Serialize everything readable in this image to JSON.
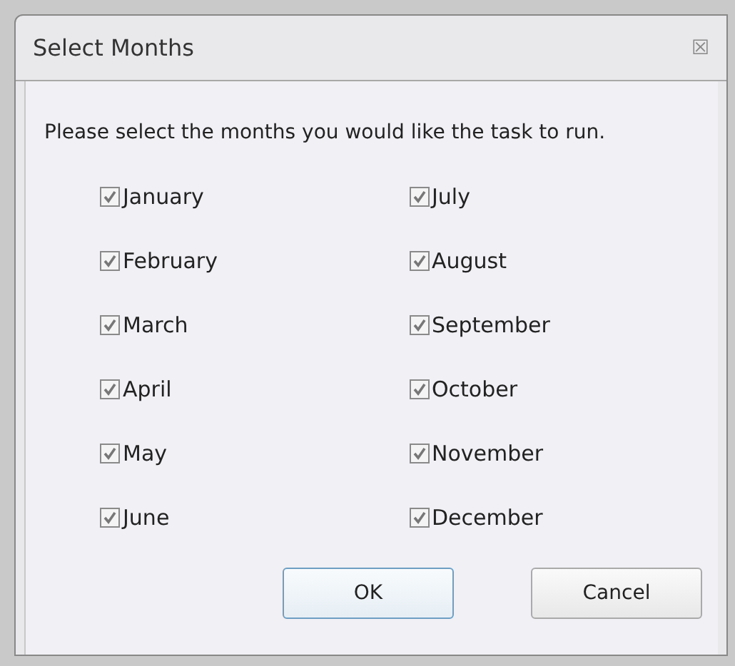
{
  "window": {
    "title": "Select Months",
    "close": "☒"
  },
  "prompt": "Please select the months you would like the task to run.",
  "months": [
    {
      "label": "January",
      "checked": true
    },
    {
      "label": "February",
      "checked": true
    },
    {
      "label": "March",
      "checked": true
    },
    {
      "label": "April",
      "checked": true
    },
    {
      "label": "May",
      "checked": true
    },
    {
      "label": "June",
      "checked": true
    },
    {
      "label": "July",
      "checked": true
    },
    {
      "label": "August",
      "checked": true
    },
    {
      "label": "September",
      "checked": true
    },
    {
      "label": "October",
      "checked": true
    },
    {
      "label": "November",
      "checked": true
    },
    {
      "label": "December",
      "checked": true
    }
  ],
  "buttons": [
    {
      "label": "OK",
      "kind": "default"
    },
    {
      "label": "Cancel",
      "kind": "normal"
    }
  ]
}
